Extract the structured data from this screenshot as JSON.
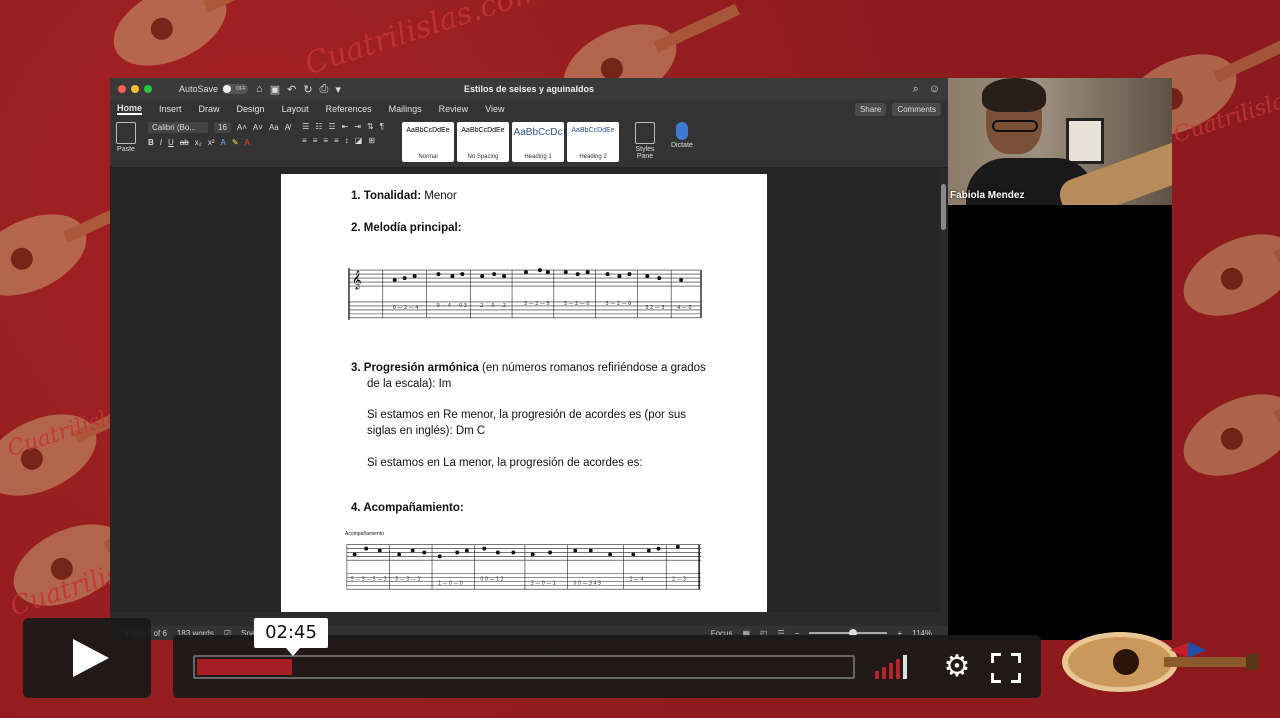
{
  "word": {
    "autosave_label": "AutoSave",
    "autosave_state": "OFF",
    "doc_title": "Estilos de seises y aguinaldos",
    "tabs": [
      "Home",
      "Insert",
      "Draw",
      "Design",
      "Layout",
      "References",
      "Mailings",
      "Review",
      "View"
    ],
    "share_label": "Share",
    "comments_label": "Comments",
    "ribbon": {
      "paste_label": "Paste",
      "font_name": "Calibri (Bo...",
      "font_size": "16",
      "styles": [
        {
          "sample": "AaBbCcDdEe",
          "name": "Normal"
        },
        {
          "sample": "AaBbCcDdEe",
          "name": "No Spacing"
        },
        {
          "sample": "AaBbCcDc",
          "name": "Heading 1"
        },
        {
          "sample": "AaBbCcDdEe",
          "name": "Heading 2"
        }
      ],
      "styles_pane_label": "Styles Pane",
      "dictate_label": "Dictate"
    },
    "doc": {
      "item1_label": "1.  Tonalidad:",
      "item1_value": " Menor",
      "item2_label": "2.  Melodía principal:",
      "item3_label": "3.  Progresión armónica",
      "item3_rest": " (en números romanos refiriéndose a grados",
      "item3_line2": "de la escala): Im",
      "para1": "Si estamos en Re menor, la progresión de acordes es (por sus siglas en inglés): Dm C",
      "para2": "Si estamos en La menor, la progresión de acordes es:",
      "item4_label": "4.  Acompañamiento:",
      "staff2_caption": "Acompañamiento"
    },
    "status": {
      "page": "Page 1 of 6",
      "words": "183 words",
      "lang": "Spanish (Puerto Rico)",
      "focus": "Focus",
      "zoom": "114%"
    }
  },
  "webcam": {
    "participant_name": "Fabiola Mendez"
  },
  "player": {
    "time": "02:45",
    "progress_fraction": 0.145,
    "volume_bars_on": 4,
    "volume_bars_total": 5,
    "accent_color": "#a51e23"
  },
  "background": {
    "brand_text": "Cuatrilislas.com"
  }
}
